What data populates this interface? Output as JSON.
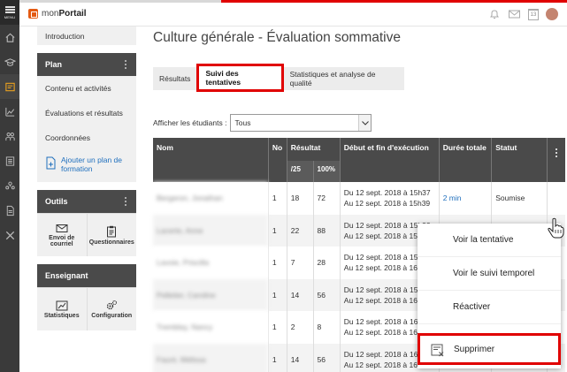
{
  "app": {
    "name_a": "mon",
    "name_b": "Portail",
    "menu_label": "MENU",
    "calendar_day": "13"
  },
  "rail_icons": [
    "home-icon",
    "graduation-cap-icon",
    "course-icon",
    "chart-icon",
    "people-icon",
    "list-icon",
    "groups-icon",
    "document-icon",
    "tools-icon"
  ],
  "left": {
    "intro": "Introduction",
    "plan": {
      "title": "Plan",
      "items": [
        "Contenu et activités",
        "Évaluations et résultats",
        "Coordonnées"
      ],
      "add": "Ajouter un plan de formation"
    },
    "outils": {
      "title": "Outils",
      "tools": [
        "Envoi de courriel",
        "Questionnaires"
      ]
    },
    "enseignant": {
      "title": "Enseignant",
      "tools": [
        "Statistiques",
        "Configuration"
      ]
    }
  },
  "main": {
    "title": "Culture générale - Évaluation sommative",
    "tabs": [
      "Résultats",
      "Suivi des tentatives",
      "Statistiques et analyse de qualité"
    ],
    "active_tab": 1,
    "filter_label": "Afficher les étudiants :",
    "filter_value": "Tous"
  },
  "table": {
    "headers": {
      "nom": "Nom",
      "no": "No",
      "resultat": "Résultat",
      "score": "/25",
      "pct": "100%",
      "dates": "Début et fin d'exécution",
      "duree": "Durée totale",
      "statut": "Statut"
    },
    "rows": [
      {
        "nom": "Bergeron, Jonathan",
        "no": "1",
        "score": "18",
        "pct": "72",
        "debut": "Du 12 sept. 2018 à 15h37",
        "fin": "Au 12 sept. 2018 à 15h39",
        "duree": "2 min",
        "statut": "Soumise"
      },
      {
        "nom": "Lacerte, Anne",
        "no": "1",
        "score": "22",
        "pct": "88",
        "debut": "Du 12 sept. 2018 à 15h32",
        "fin": "Au 12 sept. 2018 à 15h",
        "duree": "",
        "statut": ""
      },
      {
        "nom": "Lavoie, Priscilla",
        "no": "1",
        "score": "7",
        "pct": "28",
        "debut": "Du 12 sept. 2018 à 15h",
        "fin": "Au 12 sept. 2018 à 16h",
        "duree": "",
        "statut": ""
      },
      {
        "nom": "Pelletier, Caroline",
        "no": "1",
        "score": "14",
        "pct": "56",
        "debut": "Du 12 sept. 2018 à 15h",
        "fin": "Au 12 sept. 2018 à 16h",
        "duree": "",
        "statut": ""
      },
      {
        "nom": "Tremblay, Nancy",
        "no": "1",
        "score": "2",
        "pct": "8",
        "debut": "Du 12 sept. 2018 à 16h",
        "fin": "Au 12 sept. 2018 à 16h",
        "duree": "",
        "statut": ""
      },
      {
        "nom": "Fauré, Mélissa",
        "no": "1",
        "score": "14",
        "pct": "56",
        "debut": "Du 12 sept. 2018 à 16h",
        "fin": "Au 12 sept. 2018 à 16h",
        "duree": "",
        "statut": ""
      }
    ]
  },
  "menu": {
    "items": [
      "Voir la tentative",
      "Voir le suivi temporel",
      "Réactiver",
      "Supprimer"
    ]
  },
  "colors": {
    "highlight": "#e00000",
    "link": "#1f6fbd",
    "dark_header": "#4a4a4a",
    "brand": "#e45a12"
  }
}
